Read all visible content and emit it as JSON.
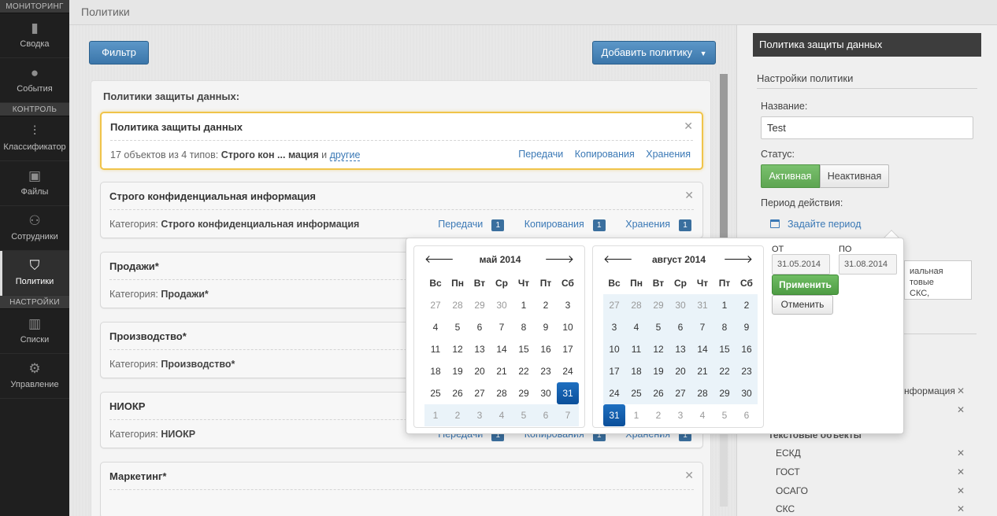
{
  "sidebar": {
    "sections": [
      {
        "title": "МОНИТОРИНГ",
        "items": [
          {
            "label": "Сводка",
            "icon": "bar-chart-icon"
          },
          {
            "label": "События",
            "icon": "chat-bubbles-icon"
          }
        ]
      },
      {
        "title": "КОНТРОЛЬ",
        "items": [
          {
            "label": "Классификатор",
            "icon": "sliders-icon"
          },
          {
            "label": "Файлы",
            "icon": "image-icon"
          },
          {
            "label": "Сотрудники",
            "icon": "users-icon"
          },
          {
            "label": "Политики",
            "icon": "shield-star-icon",
            "active": true
          }
        ]
      },
      {
        "title": "НАСТРОЙКИ",
        "items": [
          {
            "label": "Списки",
            "icon": "books-icon"
          },
          {
            "label": "Управление",
            "icon": "gears-icon"
          }
        ]
      }
    ]
  },
  "header": {
    "breadcrumb": "Политики"
  },
  "toolbar": {
    "filter_label": "Фильтр",
    "add_policy_label": "Добавить политику"
  },
  "list": {
    "title": "Политики защиты данных:",
    "cards": [
      {
        "title": "Политика защиты данных",
        "summary_prefix": "17 объектов из 4 типов: ",
        "summary_bold": "Строго кон ... мация",
        "summary_and": " и ",
        "summary_link": "другие",
        "links": [
          "Передачи",
          "Копирования",
          "Хранения"
        ]
      },
      {
        "title": "Строго конфиденциальная информация",
        "category_label": "Категория: ",
        "category": "Строго конфиденциальная информация",
        "links": [
          "Передачи",
          "Копирования",
          "Хранения"
        ],
        "badges": [
          "1",
          "1",
          "1"
        ]
      },
      {
        "title": "Продажи*",
        "category_label": "Категория: ",
        "category": "Продажи*"
      },
      {
        "title": "Производство*",
        "category_label": "Категория: ",
        "category": "Производство*"
      },
      {
        "title": "НИОКР",
        "category_label": "Категория: ",
        "category": "НИОКР",
        "links": [
          "Передачи",
          "Копирования",
          "Хранения"
        ],
        "badges": [
          "1",
          "1",
          "1"
        ]
      },
      {
        "title": "Маркетинг*"
      }
    ]
  },
  "right_panel": {
    "header": "Политика защиты данных",
    "section": "Настройки политики",
    "name_label": "Название:",
    "name_value": "Test",
    "status_label": "Статус:",
    "status_active": "Активная",
    "status_inactive": "Неактивная",
    "period_label": "Период действия:",
    "period_link": "Задайте период",
    "textarea_lines": [
      "иальная",
      "товые",
      "СКС,"
    ],
    "row_text": "нформация",
    "group_label": "текстовые объекты",
    "objects": [
      "ЕСКД",
      "ГОСТ",
      "ОСАГО",
      "СКС"
    ]
  },
  "datepicker": {
    "left": {
      "title": "май 2014",
      "weekdays": [
        "Вс",
        "Пн",
        "Вт",
        "Ср",
        "Чт",
        "Пт",
        "Сб"
      ],
      "days": [
        "27",
        "28",
        "29",
        "30",
        "1",
        "2",
        "3",
        "4",
        "5",
        "6",
        "7",
        "8",
        "9",
        "10",
        "11",
        "12",
        "13",
        "14",
        "15",
        "16",
        "17",
        "18",
        "19",
        "20",
        "21",
        "22",
        "23",
        "24",
        "25",
        "26",
        "27",
        "28",
        "29",
        "30",
        "31",
        "1",
        "2",
        "3",
        "4",
        "5",
        "6",
        "7"
      ]
    },
    "right": {
      "title": "август 2014",
      "weekdays": [
        "Вс",
        "Пн",
        "Вт",
        "Ср",
        "Чт",
        "Пт",
        "Сб"
      ],
      "days": [
        "27",
        "28",
        "29",
        "30",
        "31",
        "1",
        "2",
        "3",
        "4",
        "5",
        "6",
        "7",
        "8",
        "9",
        "10",
        "11",
        "12",
        "13",
        "14",
        "15",
        "16",
        "17",
        "18",
        "19",
        "20",
        "21",
        "22",
        "23",
        "24",
        "25",
        "26",
        "27",
        "28",
        "29",
        "30",
        "31",
        "1",
        "2",
        "3",
        "4",
        "5",
        "6"
      ]
    },
    "from_label": "ОТ",
    "to_label": "ПО",
    "from_value": "31.05.2014",
    "to_value": "31.08.2014",
    "apply_label": "Применить",
    "cancel_label": "Отменить"
  },
  "colors": {
    "accent": "#3b76aa",
    "active_green": "#5ea552",
    "selected_border": "#f0c44a",
    "sidebar": "#1f1f1f"
  }
}
